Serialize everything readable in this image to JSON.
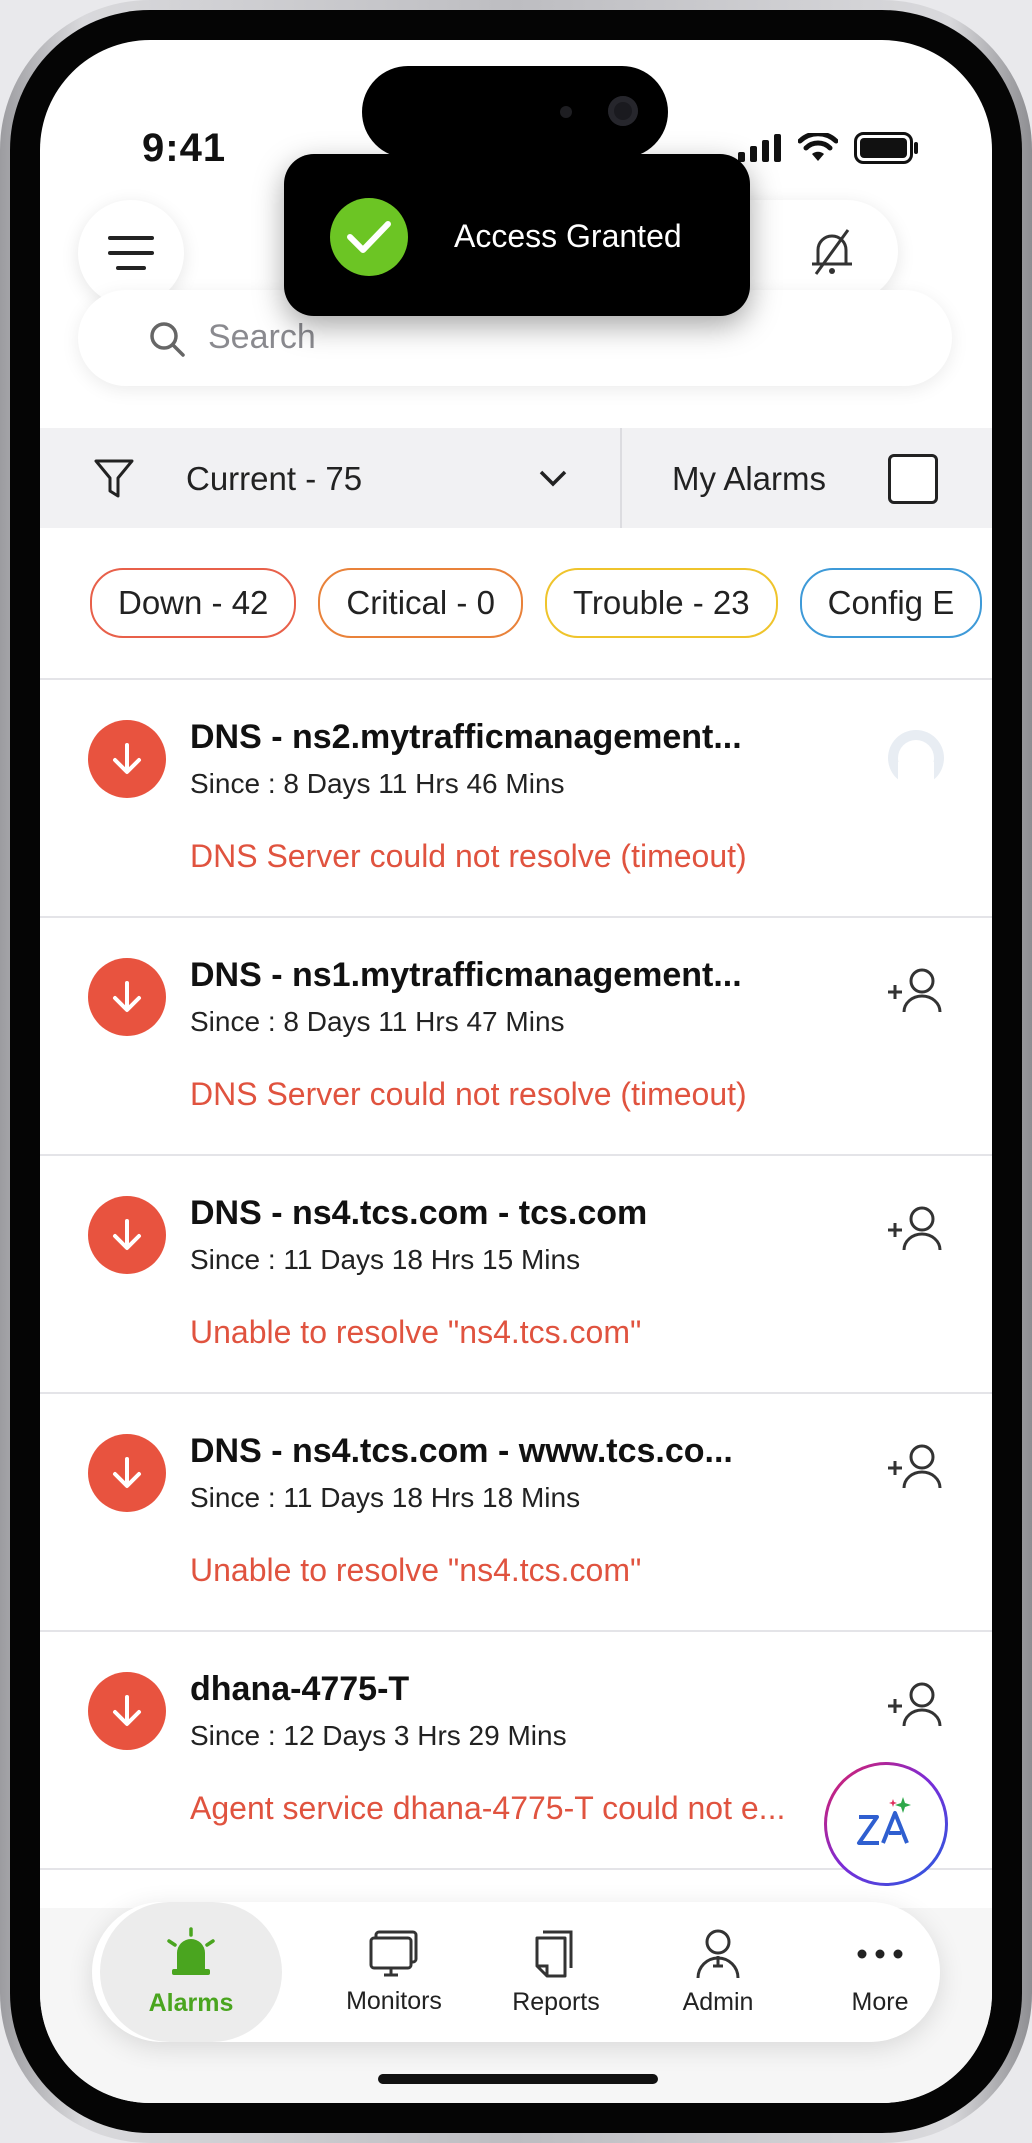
{
  "status_bar": {
    "time": "9:41"
  },
  "toast": {
    "text": "Access Granted"
  },
  "search": {
    "placeholder": "Search"
  },
  "filter": {
    "label": "Current - 75",
    "my_alarms_label": "My Alarms",
    "my_alarms_checked": false
  },
  "chips": [
    {
      "label": "Down - 42",
      "color": "#e8604a"
    },
    {
      "label": "Critical - 0",
      "color": "#e9823a"
    },
    {
      "label": "Trouble - 23",
      "color": "#efc42c"
    },
    {
      "label": "Config E",
      "color": "#3e9ad8"
    }
  ],
  "alarms": [
    {
      "title": "DNS - ns2.mytrafficmanagement...",
      "since": "Since : 8 Days 11 Hrs 46 Mins",
      "message": "DNS Server could not resolve (timeout)",
      "assigned": true
    },
    {
      "title": "DNS - ns1.mytrafficmanagement...",
      "since": "Since : 8 Days 11 Hrs 47 Mins",
      "message": "DNS Server could not resolve (timeout)",
      "assigned": false
    },
    {
      "title": "DNS - ns4.tcs.com - tcs.com",
      "since": "Since : 11 Days 18 Hrs 15 Mins",
      "message": "Unable to resolve \"ns4.tcs.com\"",
      "assigned": false
    },
    {
      "title": "DNS - ns4.tcs.com - www.tcs.co...",
      "since": "Since : 11 Days 18 Hrs 18 Mins",
      "message": "Unable to resolve \"ns4.tcs.com\"",
      "assigned": false
    },
    {
      "title": "dhana-4775-T",
      "since": "Since : 12 Days 3 Hrs 29 Mins",
      "message": "Agent service dhana-4775-T could not e...",
      "assigned": false
    }
  ],
  "nav": {
    "alarms": "Alarms",
    "monitors": "Monitors",
    "reports": "Reports",
    "admin": "Admin",
    "more": "More"
  },
  "colors": {
    "accent_green": "#4aa51f",
    "alarm_red": "#e8533f"
  }
}
